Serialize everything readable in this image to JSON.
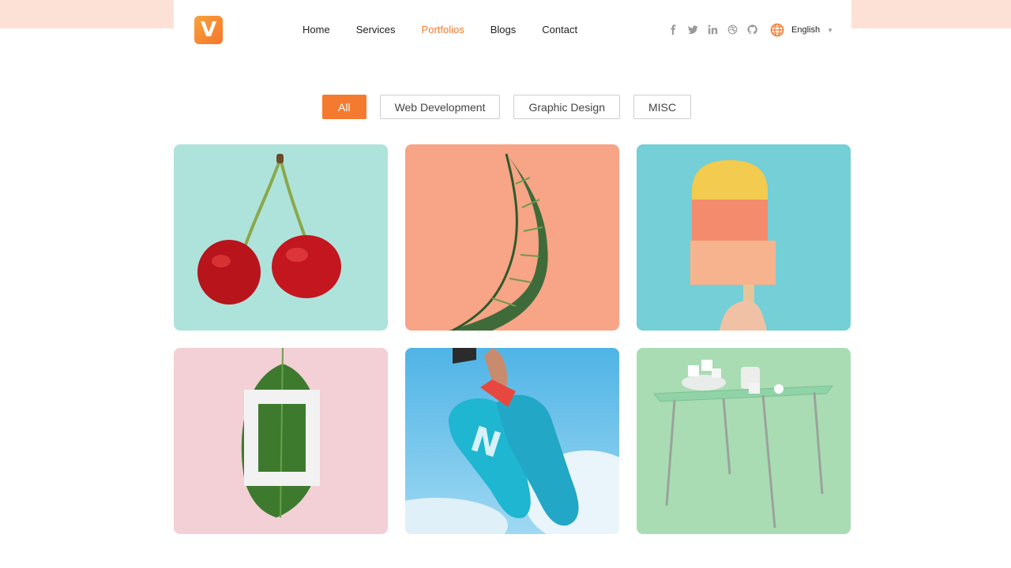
{
  "brand": {
    "logo_letter": "V",
    "accent": "#f37a2e"
  },
  "nav": {
    "items": [
      {
        "label": "Home",
        "active": false
      },
      {
        "label": "Services",
        "active": false
      },
      {
        "label": "Portfolios",
        "active": true
      },
      {
        "label": "Blogs",
        "active": false
      },
      {
        "label": "Contact",
        "active": false
      }
    ]
  },
  "social": [
    "facebook-icon",
    "twitter-icon",
    "linkedin-icon",
    "dribbble-icon",
    "github-icon"
  ],
  "language": {
    "label": "English"
  },
  "filters": {
    "items": [
      {
        "label": "All",
        "active": true
      },
      {
        "label": "Web Development",
        "active": false
      },
      {
        "label": "Graphic Design",
        "active": false
      },
      {
        "label": "MISC",
        "active": false
      }
    ]
  },
  "portfolio": {
    "items": [
      {
        "subject": "cherries",
        "background": "#aee3db"
      },
      {
        "subject": "plant",
        "background": "#f7a487"
      },
      {
        "subject": "popsicle",
        "background": "#74cfd6"
      },
      {
        "subject": "leaf-frame",
        "background": "#f3cfd6"
      },
      {
        "subject": "sneakers",
        "background": "#79c6ea"
      },
      {
        "subject": "table",
        "background": "#a9dcb3"
      }
    ]
  }
}
